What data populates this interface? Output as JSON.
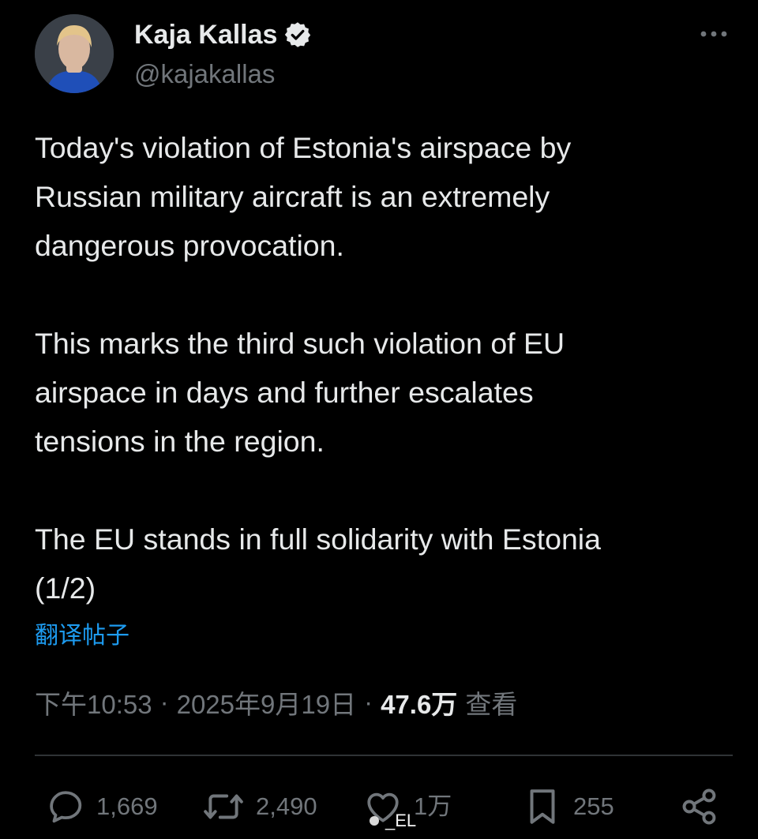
{
  "author": {
    "display_name": "Kaja Kallas",
    "handle": "@kajakallas",
    "verified": true
  },
  "tweet": {
    "paragraphs": [
      "Today's violation of Estonia's airspace by\nRussian military aircraft is an extremely\ndangerous provocation.",
      "This marks the third such violation of EU\nairspace in days and further escalates\ntensions in the region.",
      "The EU stands in full solidarity with Estonia\n(1/2)"
    ],
    "translate_label": "翻译帖子"
  },
  "meta": {
    "time": "下午10:53",
    "separator": "·",
    "date": "2025年9月19日",
    "views_count": "47.6万",
    "views_label": "查看"
  },
  "actions": {
    "replies": "1,669",
    "reposts": "2,490",
    "likes": "1万",
    "bookmarks": "255"
  },
  "watermark": {
    "text": "_EL"
  },
  "colors": {
    "background": "#000000",
    "text_primary": "#e7e9ea",
    "text_secondary": "#71767b",
    "link": "#1d9bf0",
    "divider": "#2f3336",
    "verified_badge": "#e7e9ea"
  },
  "icons": {
    "verified": "verified-badge-icon",
    "more": "more-horizontal-icon",
    "reply": "reply-bubble-icon",
    "repost": "repost-icon",
    "like": "heart-icon",
    "bookmark": "bookmark-icon",
    "share": "share-icon"
  }
}
